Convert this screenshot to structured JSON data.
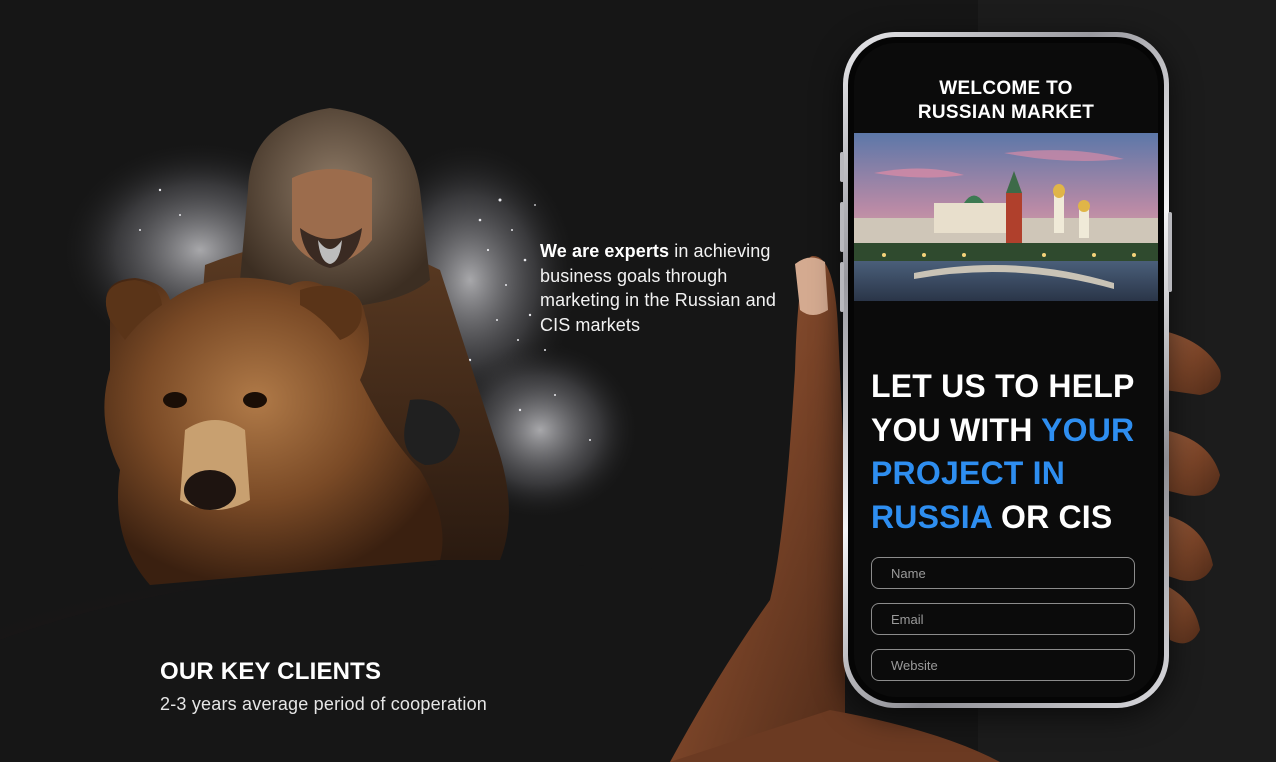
{
  "hero": {
    "intro_strong": "We are experts",
    "intro_rest": " in achieving business goals through marketing in the Russian and CIS markets"
  },
  "clients": {
    "title": "OUR KEY CLIENTS",
    "subtitle": "2-3 years average period of cooperation"
  },
  "phone": {
    "header_line1": "WELCOME TO",
    "header_line2": "RUSSIAN MARKET",
    "headline_white_1": "LET US TO HELP YOU WITH ",
    "headline_blue": "YOUR PROJECT IN RUSSIA",
    "headline_white_2": " OR CIS",
    "form": {
      "name_placeholder": "Name",
      "email_placeholder": "Email",
      "website_placeholder": "Website"
    }
  },
  "colors": {
    "accent_blue": "#2e8ef0",
    "background": "#161616",
    "glow_red": "#c41228"
  }
}
